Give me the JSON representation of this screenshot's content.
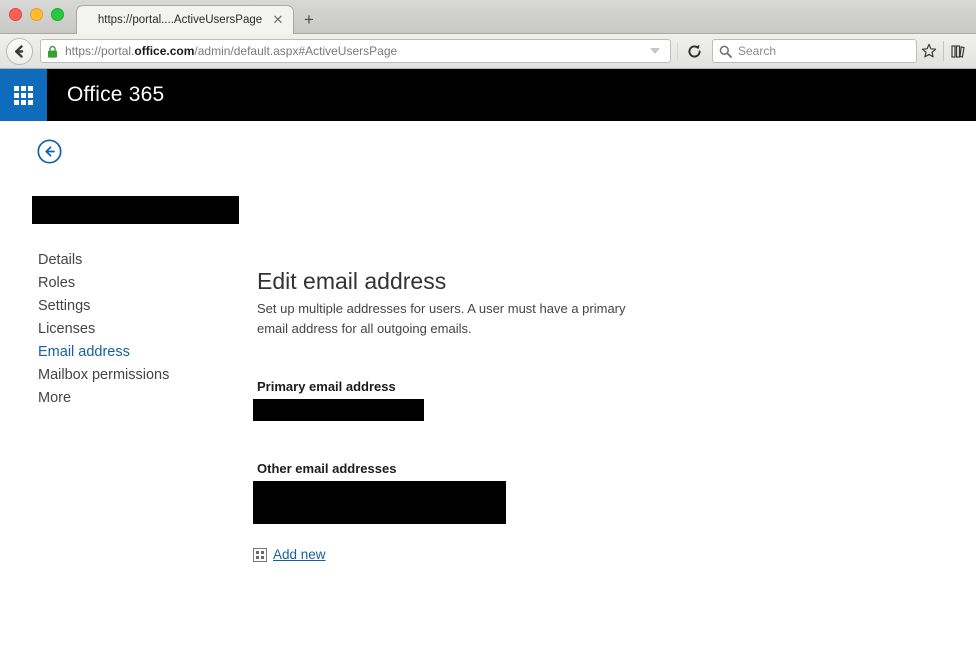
{
  "browser": {
    "window_controls": [
      "close",
      "minimize",
      "maximize"
    ],
    "tab": {
      "title": "https://portal....ActiveUsersPage",
      "close_label": "✕"
    },
    "new_tab_label": "+",
    "back_button_name": "back",
    "address": {
      "url_prefix": "https://portal.",
      "url_domain": "office.com",
      "url_suffix": "/admin/default.aspx#ActiveUsersPage",
      "full_url": "https://portal.office.com/admin/default.aspx#ActiveUsersPage",
      "secure": true
    },
    "search": {
      "placeholder": "Search",
      "value": ""
    },
    "bookmark_icon": "star-icon",
    "library_icon": "library-icon"
  },
  "suitebar": {
    "app_launcher": "waffle-icon",
    "brand": "Office 365"
  },
  "page": {
    "back_label": "←",
    "user_name_redacted": "",
    "nav": {
      "items": [
        {
          "label": "Details",
          "selected": false
        },
        {
          "label": "Roles",
          "selected": false
        },
        {
          "label": "Settings",
          "selected": false
        },
        {
          "label": "Licenses",
          "selected": false
        },
        {
          "label": "Email address",
          "selected": true
        },
        {
          "label": "Mailbox permissions",
          "selected": false
        },
        {
          "label": "More",
          "selected": false
        }
      ]
    },
    "main": {
      "title": "Edit email address",
      "description": "Set up multiple addresses for users. A user must have a primary email address for all outgoing emails.",
      "primary_label": "Primary email address",
      "primary_value_redacted": "",
      "other_label": "Other email addresses",
      "other_value_redacted": "",
      "add_new_label": "Add new",
      "add_new_icon": "broken-image-icon"
    }
  },
  "colors": {
    "accent_blue": "#0f6cbd",
    "link_blue": "#1261a8",
    "suitebar_black": "#000000",
    "redaction_black": "#000000"
  }
}
